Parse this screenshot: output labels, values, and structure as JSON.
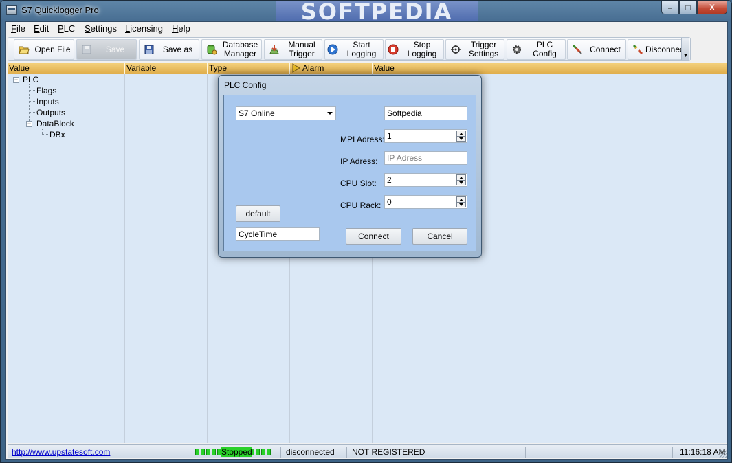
{
  "window": {
    "title": "S7 Quicklogger Pro",
    "watermark": "SOFTPEDIA",
    "controls": {
      "minimize": "–",
      "maximize": "□",
      "close": "X"
    }
  },
  "menu": {
    "items": [
      {
        "accel": "F",
        "rest": "ile"
      },
      {
        "accel": "E",
        "rest": "dit"
      },
      {
        "accel": "P",
        "rest": "LC"
      },
      {
        "accel": "S",
        "rest": "ettings"
      },
      {
        "accel": "L",
        "rest": "icensing"
      },
      {
        "accel": "H",
        "rest": "elp"
      }
    ]
  },
  "toolbar": {
    "open_file": "Open File",
    "save": "Save",
    "save_as": "Save as",
    "database_manager": [
      "Database",
      "Manager"
    ],
    "manual_trigger": [
      "Manual",
      "Trigger"
    ],
    "start_logging": "Start Logging",
    "stop_logging": "Stop Logging",
    "trigger_settings": [
      "Trigger",
      "Settings"
    ],
    "plc_config": "PLC Config",
    "connect": "Connect",
    "disconnect": "Disconnect"
  },
  "grid": {
    "columns": [
      "Value",
      "Variable",
      "Type",
      "Alarm",
      "Value"
    ],
    "tree": {
      "root": "PLC",
      "children": [
        "Flags",
        "Inputs",
        "Outputs",
        "DataBlock"
      ],
      "datablock_children": [
        "DBx"
      ]
    }
  },
  "dialog": {
    "title": "PLC Config",
    "connection_type": "S7 Online",
    "name_value": "Softpedia",
    "mpi_label": "MPI Adress:",
    "mpi_value": "1",
    "ip_label": "IP Adress:",
    "ip_placeholder": "IP Adress",
    "slot_label": "CPU Slot:",
    "slot_value": "2",
    "rack_label": "CPU Rack:",
    "rack_value": "0",
    "default_button": "default",
    "cycletime_value": "CycleTime",
    "connect_button": "Connect",
    "cancel_button": "Cancel"
  },
  "status": {
    "link": "http://www.upstatesoft.com",
    "state": "Stopped",
    "connection": "disconnected",
    "registration": "NOT REGISTERED",
    "clock": "11:16:18 AM"
  },
  "colors": {
    "grid_header": "#e0ae4c",
    "grid_background": "#dbe8f6",
    "dialog_body": "#a9c8ee",
    "progress_green": "#2ad12a"
  }
}
